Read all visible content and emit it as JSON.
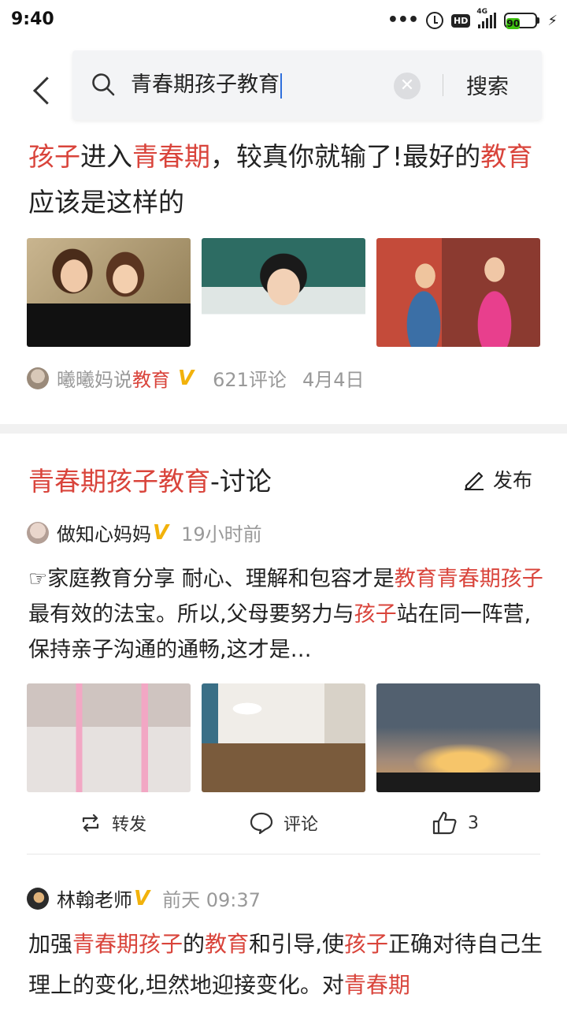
{
  "status_bar": {
    "time": "9:40",
    "network": "4G",
    "hd": "HD",
    "battery": "90"
  },
  "search": {
    "query": "青春期孩子教育",
    "submit_label": "搜索"
  },
  "article": {
    "title_parts": [
      {
        "text": "孩子",
        "hl": true
      },
      {
        "text": "进入",
        "hl": false
      },
      {
        "text": "青春期",
        "hl": true
      },
      {
        "text": "，较真你就输了!最好的",
        "hl": false
      },
      {
        "text": "教育",
        "hl": true
      },
      {
        "text": "应该是这样的",
        "hl": false
      }
    ],
    "author_prefix": "曦曦妈说",
    "author_hl": "教育",
    "comments": "621评论",
    "date": "4月4日"
  },
  "discussion": {
    "title_hl": "青春期孩子教育",
    "title_rest": "-讨论",
    "publish_label": "发布"
  },
  "post1": {
    "author": "做知心妈妈",
    "time": "19小时前",
    "text_parts": [
      {
        "text": "☞家庭教育分享 耐心、理解和包容才是",
        "hl": false
      },
      {
        "text": "教育青春期孩子",
        "hl": true
      },
      {
        "text": "最有效的法宝。所以,父母要努力与",
        "hl": false
      },
      {
        "text": "孩子",
        "hl": true
      },
      {
        "text": "站在同一阵营,保持亲子沟通的通畅,这才是…",
        "hl": false
      }
    ],
    "repost_label": "转发",
    "comment_label": "评论",
    "like_count": "3"
  },
  "post2": {
    "author": "林翰老师",
    "time": "前天 09:37",
    "text_parts": [
      {
        "text": "加强",
        "hl": false
      },
      {
        "text": "青春期孩子",
        "hl": true
      },
      {
        "text": "的",
        "hl": false
      },
      {
        "text": "教育",
        "hl": true
      },
      {
        "text": "和引导,使",
        "hl": false
      },
      {
        "text": "孩子",
        "hl": true
      },
      {
        "text": "正确对待自己生理上的变化,坦然地迎接变化。对",
        "hl": false
      },
      {
        "text": "青春期",
        "hl": true
      }
    ]
  },
  "colors": {
    "highlight": "#d9443b",
    "meta": "#999999",
    "verified": "#f2b20b"
  }
}
